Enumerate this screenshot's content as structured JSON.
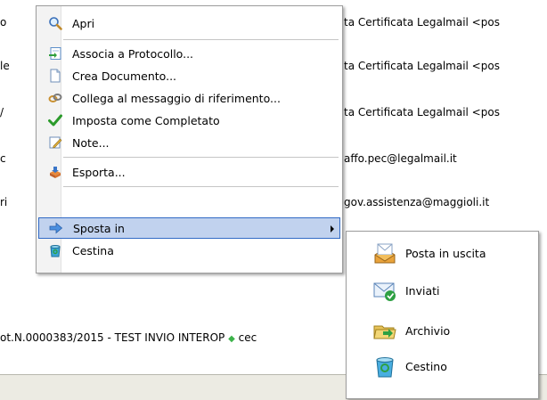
{
  "background_rows": [
    {
      "left": "o",
      "right": "ta Certificata Legalmail <pos"
    },
    {
      "left": "le",
      "right": "ta Certificata Legalmail <pos"
    },
    {
      "left": "/",
      "right": "ta Certificata Legalmail <pos"
    },
    {
      "left": "c",
      "right": "affo.pec@legalmail.it"
    },
    {
      "left": "ri",
      "right": "gov.assistenza@maggioli.it"
    }
  ],
  "background_bottom_row": {
    "text": "ot.N.0000383/2015 - TEST INVIO INTEROP",
    "tail": "cec"
  },
  "context_menu": {
    "items": [
      {
        "label": "Apri",
        "icon": "magnifier-icon"
      },
      {
        "label": "Associa a Protocollo...",
        "icon": "associate-protocol-icon"
      },
      {
        "label": "Crea Documento...",
        "icon": "document-icon"
      },
      {
        "label": "Collega al messaggio di riferimento...",
        "icon": "link-message-icon"
      },
      {
        "label": "Imposta come Completato",
        "icon": "checkmark-icon"
      },
      {
        "label": "Note...",
        "icon": "note-icon"
      },
      {
        "label": "Esporta...",
        "icon": "export-icon"
      },
      {
        "label": "Sposta in",
        "icon": "arrow-right-icon"
      },
      {
        "label": "Cestina",
        "icon": "trash-icon"
      }
    ]
  },
  "submenu": {
    "items": [
      {
        "label": "Posta in uscita",
        "icon": "outbox-icon"
      },
      {
        "label": "Inviati",
        "icon": "sent-icon"
      },
      {
        "label": "Archivio",
        "icon": "archive-icon"
      },
      {
        "label": "Cestino",
        "icon": "recycle-bin-icon"
      }
    ]
  },
  "colors": {
    "selection": "#316ac5",
    "hover_fill": "#c1d2ee",
    "menu_border": "#9d9d9d"
  }
}
